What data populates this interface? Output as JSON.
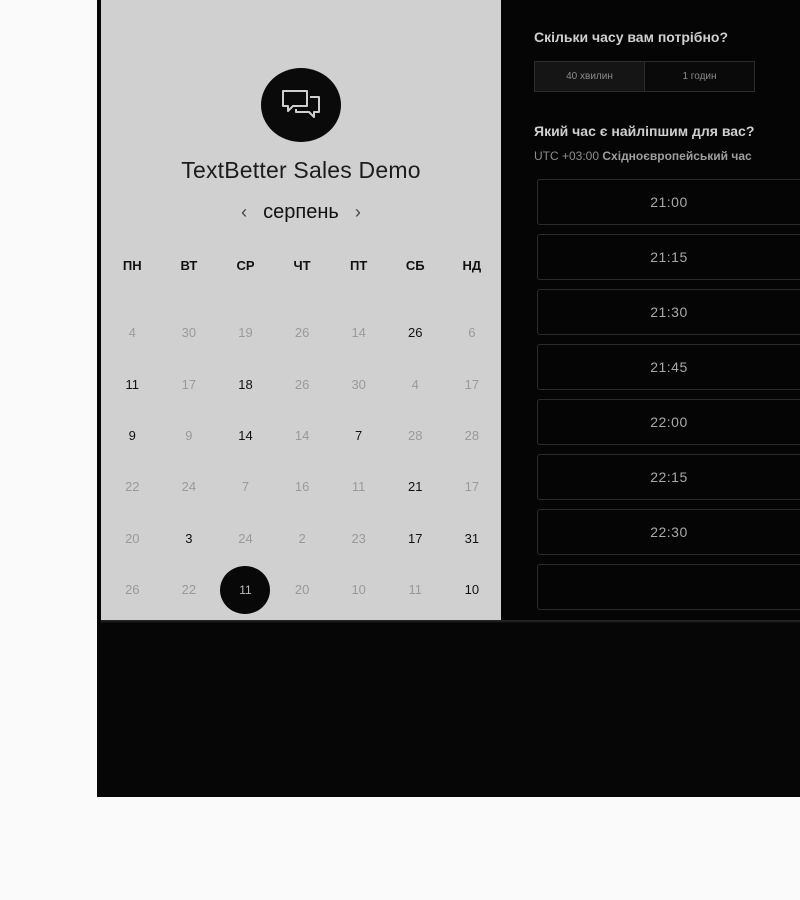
{
  "event": {
    "title": "TextBetter Sales Demo",
    "logo_icon": "chat-bubbles-icon"
  },
  "calendar": {
    "month": "серпень",
    "prev_icon": "chevron-left-icon",
    "next_icon": "chevron-right-icon",
    "weekdays": [
      "ПН",
      "ВТ",
      "СР",
      "ЧТ",
      "ПТ",
      "СБ",
      "НД"
    ],
    "weeks": [
      [
        {
          "d": "4",
          "on": false
        },
        {
          "d": "30",
          "on": false
        },
        {
          "d": "19",
          "on": false
        },
        {
          "d": "26",
          "on": false
        },
        {
          "d": "14",
          "on": false
        },
        {
          "d": "26",
          "on": true
        },
        {
          "d": "6",
          "on": false
        }
      ],
      [
        {
          "d": "11",
          "on": true
        },
        {
          "d": "17",
          "on": false
        },
        {
          "d": "18",
          "on": true
        },
        {
          "d": "26",
          "on": false
        },
        {
          "d": "30",
          "on": false
        },
        {
          "d": "4",
          "on": false
        },
        {
          "d": "17",
          "on": false
        }
      ],
      [
        {
          "d": "9",
          "on": true
        },
        {
          "d": "9",
          "on": false
        },
        {
          "d": "14",
          "on": true
        },
        {
          "d": "14",
          "on": false
        },
        {
          "d": "7",
          "on": true
        },
        {
          "d": "28",
          "on": false
        },
        {
          "d": "28",
          "on": false
        }
      ],
      [
        {
          "d": "22",
          "on": false
        },
        {
          "d": "24",
          "on": false
        },
        {
          "d": "7",
          "on": false
        },
        {
          "d": "16",
          "on": false
        },
        {
          "d": "11",
          "on": false
        },
        {
          "d": "21",
          "on": true
        },
        {
          "d": "17",
          "on": false
        }
      ],
      [
        {
          "d": "20",
          "on": false
        },
        {
          "d": "3",
          "on": true
        },
        {
          "d": "24",
          "on": false
        },
        {
          "d": "2",
          "on": false
        },
        {
          "d": "23",
          "on": false
        },
        {
          "d": "17",
          "on": true
        },
        {
          "d": "31",
          "on": true
        }
      ],
      [
        {
          "d": "26",
          "on": false
        },
        {
          "d": "22",
          "on": false
        },
        {
          "d": "11",
          "on": true,
          "selected": true
        },
        {
          "d": "20",
          "on": false
        },
        {
          "d": "10",
          "on": false
        },
        {
          "d": "11",
          "on": false
        },
        {
          "d": "10",
          "on": true
        }
      ]
    ]
  },
  "booking": {
    "duration_question": "Скільки часу вам потрібно?",
    "durations": [
      {
        "label": "40 хвилин",
        "active": true
      },
      {
        "label": "1 годин",
        "active": false
      }
    ],
    "time_question": "Який час є найліпшим для вас?",
    "timezone_offset": "UTC +03:00",
    "timezone_name": "Східноєвропейський час",
    "slots": [
      "21:00",
      "21:15",
      "21:30",
      "21:45",
      "22:00",
      "22:15",
      "22:30",
      ""
    ]
  },
  "colors": {
    "left_panel": "#d0d0d0",
    "right_panel": "#050505",
    "selected_day": "#080808"
  }
}
